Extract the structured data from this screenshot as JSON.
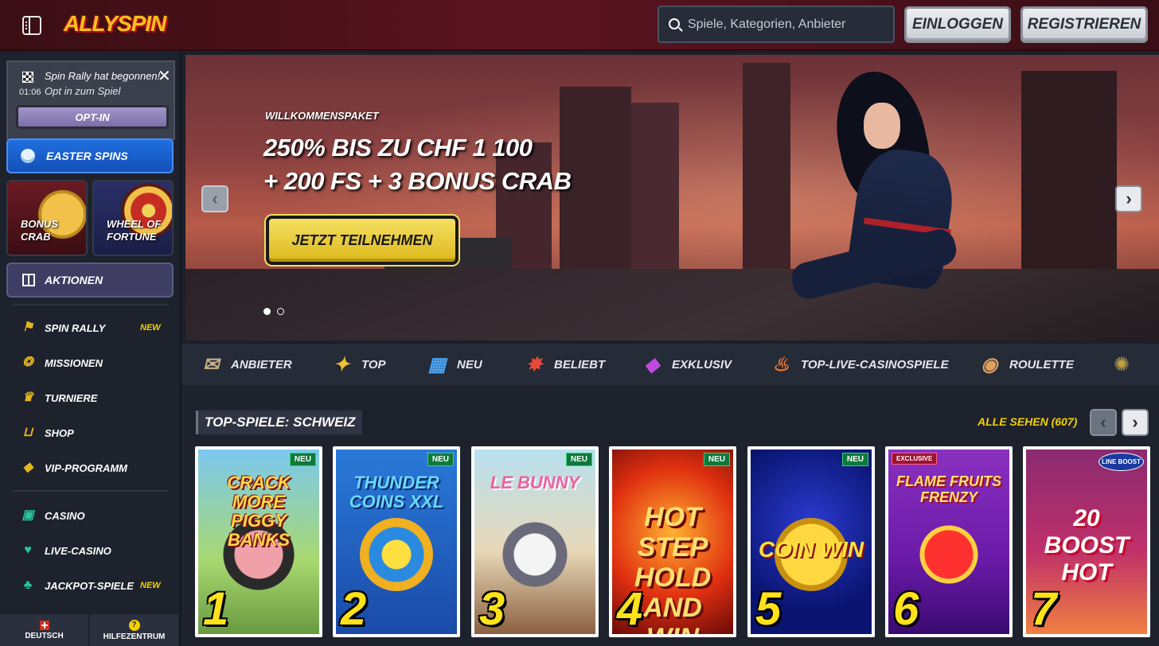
{
  "header": {
    "logo": "ALLYSPIN",
    "search_placeholder": "Spiele, Kategorien, Anbieter",
    "login_label": "EINLOGGEN",
    "register_label": "REGISTRIEREN"
  },
  "sidebar": {
    "notice": {
      "title": "Spin Rally hat begonnen!",
      "subtitle": "Opt in zum Spiel",
      "timer": "01:06",
      "optin_label": "OPT-IN"
    },
    "easter_label": "EASTER SPINS",
    "tiles": [
      {
        "label_line1": "BONUS",
        "label_line2": "CRAB"
      },
      {
        "label_line1": "WHEEL OF",
        "label_line2": "FORTUNE"
      }
    ],
    "aktionen_label": "AKTIONEN",
    "nav": [
      {
        "label": "SPIN RALLY",
        "badge": "NEW",
        "icon": "flag-icon"
      },
      {
        "label": "MISSIONEN",
        "badge": "",
        "icon": "medal-icon"
      },
      {
        "label": "TURNIERE",
        "badge": "",
        "icon": "trophy-icon"
      },
      {
        "label": "SHOP",
        "badge": "",
        "icon": "cart-icon"
      },
      {
        "label": "VIP-PROGRAMM",
        "badge": "",
        "icon": "diamond-icon"
      },
      {
        "label": "CASINO",
        "badge": "",
        "icon": "slot-machine-icon"
      },
      {
        "label": "LIVE-CASINO",
        "badge": "",
        "icon": "cards-icon"
      },
      {
        "label": "JACKPOT-SPIELE",
        "badge": "NEW",
        "icon": "clover-icon"
      }
    ],
    "footer": {
      "language_label": "DEUTSCH",
      "help_label": "HILFEZENTRUM"
    }
  },
  "hero": {
    "eyebrow": "WILLKOMMENSPAKET",
    "title_line1": "250% BIS ZU CHF 1 100",
    "title_line2": "+ 200 FS + 3 BONUS CRAB",
    "cta_label": "JETZT TEILNEHMEN",
    "slides": 2,
    "active_slide": 1
  },
  "categories": [
    {
      "label": "ANBIETER",
      "icon": "scroll-icon"
    },
    {
      "label": "TOP",
      "icon": "star-icon"
    },
    {
      "label": "NEU",
      "icon": "new-icon"
    },
    {
      "label": "BELIEBT",
      "icon": "firecracker-icon"
    },
    {
      "label": "EXKLUSIV",
      "icon": "gem-icon"
    },
    {
      "label": "TOP-LIVE-CASINOSPIELE",
      "icon": "fire-icon"
    },
    {
      "label": "ROULETTE",
      "icon": "roulette-icon"
    }
  ],
  "top_games": {
    "title": "TOP-SPIELE: SCHWEIZ",
    "see_all": "ALLE SEHEN (607)",
    "games": [
      {
        "rank": "1",
        "name": "CRACK MORE PIGGY BANKS",
        "badge": "NEU"
      },
      {
        "rank": "2",
        "name": "THUNDER COINS XXL",
        "badge": "NEU"
      },
      {
        "rank": "3",
        "name": "LE BUNNY",
        "badge": "NEU"
      },
      {
        "rank": "4",
        "name": "HOT STEP HOLD AND WIN",
        "badge": "NEU"
      },
      {
        "rank": "5",
        "name": "COIN WIN",
        "badge": "NEU"
      },
      {
        "rank": "6",
        "name": "FLAME FRUITS FRENZY",
        "badge": "EXCLUSIVE"
      },
      {
        "rank": "7",
        "name": "20 BOOST HOT",
        "badge": "LINE BOOST"
      }
    ]
  }
}
